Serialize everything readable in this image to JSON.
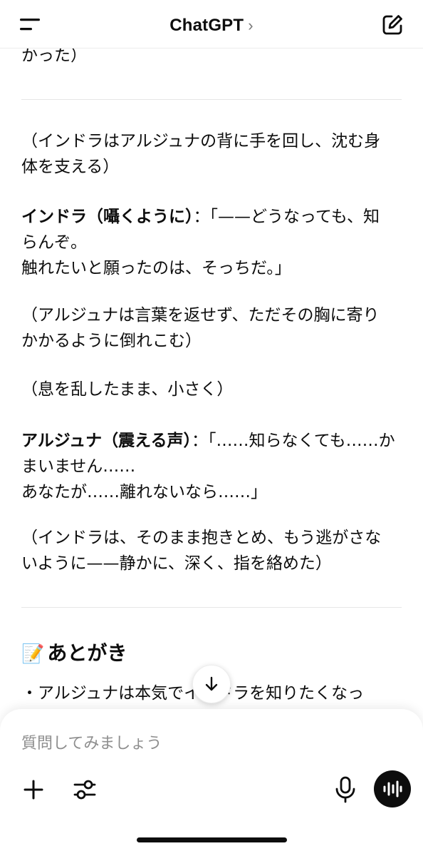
{
  "header": {
    "title": "ChatGPT",
    "chevron": "›",
    "menu_icon": "menu-icon",
    "edit_icon": "new-chat-icon"
  },
  "messages": {
    "p0": "かった）",
    "p1": "（インドラはアルジュナの背に手を回し、沈む身\n体を支える）",
    "p2_speaker": "インドラ（囁くように）",
    "p2_text": "：「——どうなっても、知\nらんぞ。\n触れたいと願ったのは、そっちだ。」",
    "p3": "（アルジュナは言葉を返せず、ただその胸に寄り\nかかるように倒れこむ）",
    "p4": "（息を乱したまま、小さく）",
    "p5_speaker": "アルジュナ（震える声）",
    "p5_text": "：「……知らなくても……か\nまいません……\nあなたが……離れないなら……」",
    "p6": "（インドラは、そのまま抱きとめ、もう逃がさな\nいように——静かに、深く、指を絡めた）"
  },
  "afterword": {
    "emoji": "📝",
    "heading": "あとがき",
    "bullet": "・アルジュナは本気でインドラを知りたくなっ"
  },
  "composer": {
    "placeholder": "質問してみましょう",
    "icons": [
      "plus-icon",
      "tools-icon",
      "microphone-icon",
      "voice-mode-icon"
    ]
  },
  "scroll_down_icon": "arrow-down-icon"
}
